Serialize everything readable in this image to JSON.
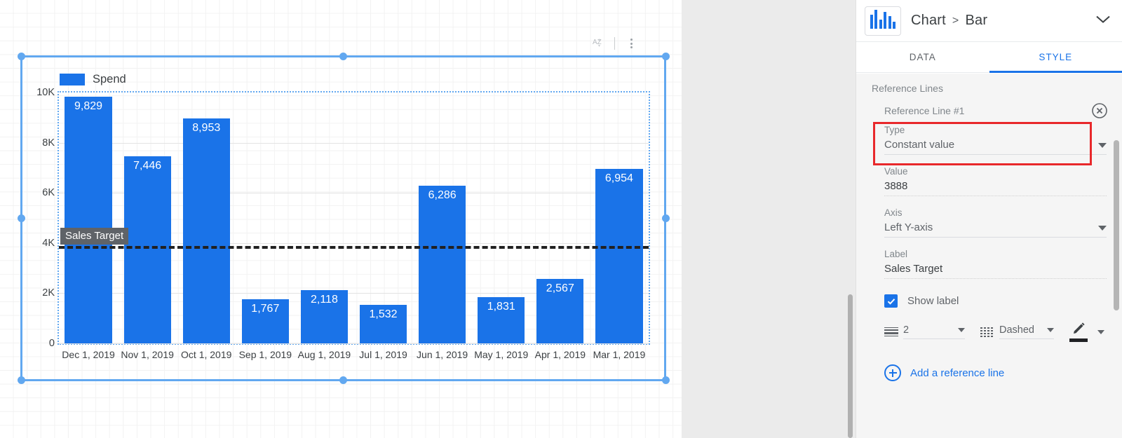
{
  "chart_toolbar": {
    "sort_icon": "sort-az-icon",
    "more_icon": "more-vert-icon"
  },
  "chart_data": {
    "type": "bar",
    "title": "",
    "xlabel": "",
    "ylabel": "",
    "ylim": [
      0,
      10000
    ],
    "ytick_labels": [
      "10K",
      "8K",
      "6K",
      "4K",
      "2K",
      "0"
    ],
    "ytick_values": [
      10000,
      8000,
      6000,
      4000,
      2000,
      0
    ],
    "grid": true,
    "legend": {
      "position": "top-left",
      "entries": [
        "Spend"
      ]
    },
    "series_color": "#1a73e8",
    "categories": [
      "Dec 1, 2019",
      "Nov 1, 2019",
      "Oct 1, 2019",
      "Sep 1, 2019",
      "Aug 1, 2019",
      "Jul 1, 2019",
      "Jun 1, 2019",
      "May 1, 2019",
      "Apr 1, 2019",
      "Mar 1, 2019"
    ],
    "series": [
      {
        "name": "Spend",
        "values": [
          9829,
          7446,
          8953,
          1767,
          2118,
          1532,
          6286,
          1831,
          2567,
          6954
        ],
        "data_labels": [
          "9,829",
          "7,446",
          "8,953",
          "1,767",
          "2,118",
          "1,532",
          "6,286",
          "1,831",
          "2,567",
          "6,954"
        ]
      }
    ],
    "reference_line": {
      "label": "Sales Target",
      "value": 3888,
      "style": "Dashed",
      "weight": 2,
      "color": "#212121",
      "axis": "Left Y-axis"
    }
  },
  "panel": {
    "chart_type_icon": "bar-chart-icon",
    "title": "Chart",
    "title_sep": ">",
    "subtitle": "Bar",
    "collapse_icon": "chevron-down-icon",
    "tabs": [
      {
        "label": "DATA",
        "active": false
      },
      {
        "label": "STYLE",
        "active": true
      }
    ],
    "section_title": "Reference Lines",
    "reference_line": {
      "name": "Reference Line #1",
      "remove_icon": "close-circle-icon",
      "type_field": {
        "label": "Type",
        "value": "Constant value",
        "dropdown_icon": "caret-down-icon",
        "highlight_color": "#e8282b"
      },
      "value_field": {
        "label": "Value",
        "value": "3888"
      },
      "axis_field": {
        "label": "Axis",
        "value": "Left Y-axis",
        "dropdown_icon": "caret-down-icon"
      },
      "label_field": {
        "label": "Label",
        "value": "Sales Target"
      },
      "show_label": {
        "label": "Show label",
        "checked": true
      },
      "weight_select": {
        "icon": "line-weight-icon",
        "value": "2",
        "dropdown_icon": "caret-down-icon"
      },
      "dash_select": {
        "icon": "line-dash-icon",
        "value": "Dashed",
        "dropdown_icon": "caret-down-icon"
      },
      "color_picker": {
        "icon": "pencil-icon",
        "swatch": "#202124",
        "dropdown_icon": "caret-down-icon"
      }
    },
    "add_reference_line": {
      "icon": "plus-circle-icon",
      "label": "Add a reference line"
    }
  },
  "colors": {
    "accent": "#1a73e8",
    "selection": "#62a8f0",
    "highlight": "#e8282b",
    "badge_bg": "#5f6368"
  }
}
